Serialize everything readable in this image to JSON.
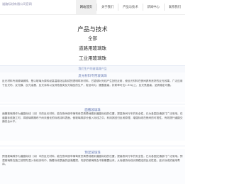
{
  "topbar": {
    "brand": "道路标线有限公司官网",
    "nav": [
      "网站首页",
      "关于我们",
      "产品与技术",
      "新闻中心",
      "联系我们"
    ],
    "active_index": 0
  },
  "header": {
    "title": "产品与技术",
    "links": [
      "全部",
      "道路用玻璃珠",
      "工业用玻璃珠"
    ]
  },
  "bluebar": {
    "text": "我们生产的玻璃珠产品"
  },
  "sections": [
    {
      "title": "反光材料专用玻璃珠",
      "body": "反光材料专用玻璃微珠，是以玻璃为原料经高温熔化后制成的透明球状材料，它能够对光线产生回归反射，使反光材料在夜间具有良好的反光效果。广泛应用于反光布、反光膜、反光油墨、反光涂料以及其他各类反光制品的生产，粒径均匀，圆整度高，折射率可达1.93以上，反光亮度高，品质稳定可靠。"
    },
    {
      "title": "面撒玻璃珠",
      "body": "面撒玻璃珠作为道路标线（涂）中的反光材料，能在夜间使车辆驾驶员清楚地看到道路标线的位置，提高夜间行车的安全性，已为各国交通部门广泛采用。在道路标线施工时，将玻璃珠撒布于尚未固化的标线涂料表面，使玻璃珠部分嵌入标线之中，利用其回归反射原理，增强标线在夜间的可视性，有效提升道路交通安全水平。"
    },
    {
      "title": "预混玻璃珠",
      "body": "预混玻璃珠作为道路标线（涂）中的反光材料，能在夜间使车辆驾驶员清楚地看到道路标线的位置，提高夜间行车的安全性，已为各国交通部门广泛采用。预混玻璃珠在施工前预先混入标线涂料中，随着标线表面的逐渐磨损，内部的玻璃珠会不断暴露出来，从而保持标线长期稳定的反光性能，延长标线的使用寿命。"
    }
  ]
}
